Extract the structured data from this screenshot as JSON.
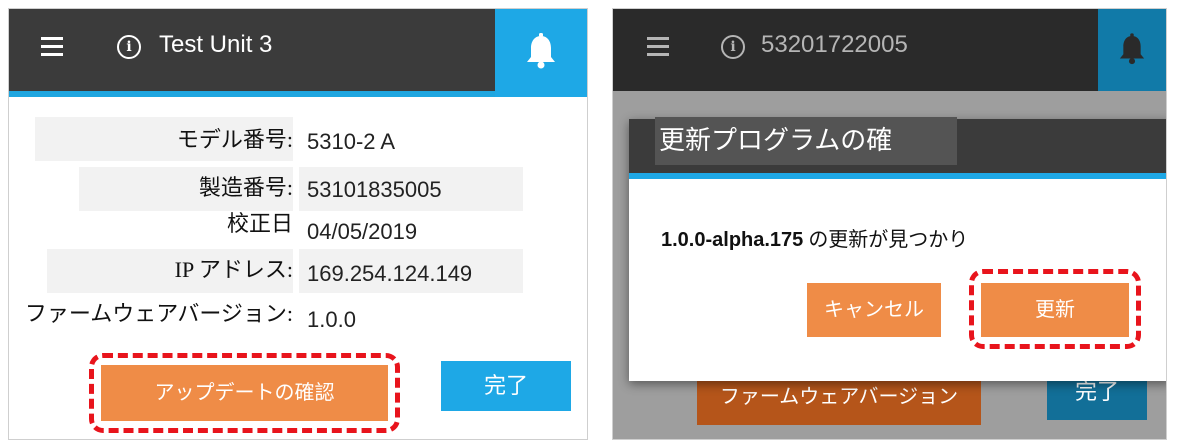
{
  "left": {
    "header": {
      "title": "Test Unit 3",
      "info_icon": "i"
    },
    "rows": [
      {
        "label": "モデル番号:",
        "value": "5310-2 A"
      },
      {
        "label": "製造番号:",
        "value": "53101835005"
      },
      {
        "label": "校正日",
        "value": "04/05/2019"
      },
      {
        "label": "IP アドレス:",
        "value": "169.254.124.149"
      },
      {
        "label": "ファームウェアバージョン:",
        "value": "1.0.0"
      }
    ],
    "check_update_button": "アップデートの確認",
    "done_button": "完了"
  },
  "right": {
    "header": {
      "title": "53201722005",
      "info_icon": "i"
    },
    "dialog": {
      "title": "更新プログラムの確",
      "message_bold": "1.0.0-alpha.175",
      "message_rest": " の更新が見つかり",
      "cancel_button": "キャンセル",
      "update_button": "更新"
    },
    "firmware_button": "ファームウェアバージョン",
    "done_button": "完了"
  },
  "colors": {
    "header_bg": "#3b3b3b",
    "accent_blue": "#1ea8e6",
    "button_orange": "#ef8c47",
    "highlight_red": "#e8141c"
  },
  "icons": [
    "menu-icon",
    "info-icon",
    "bell-icon"
  ]
}
